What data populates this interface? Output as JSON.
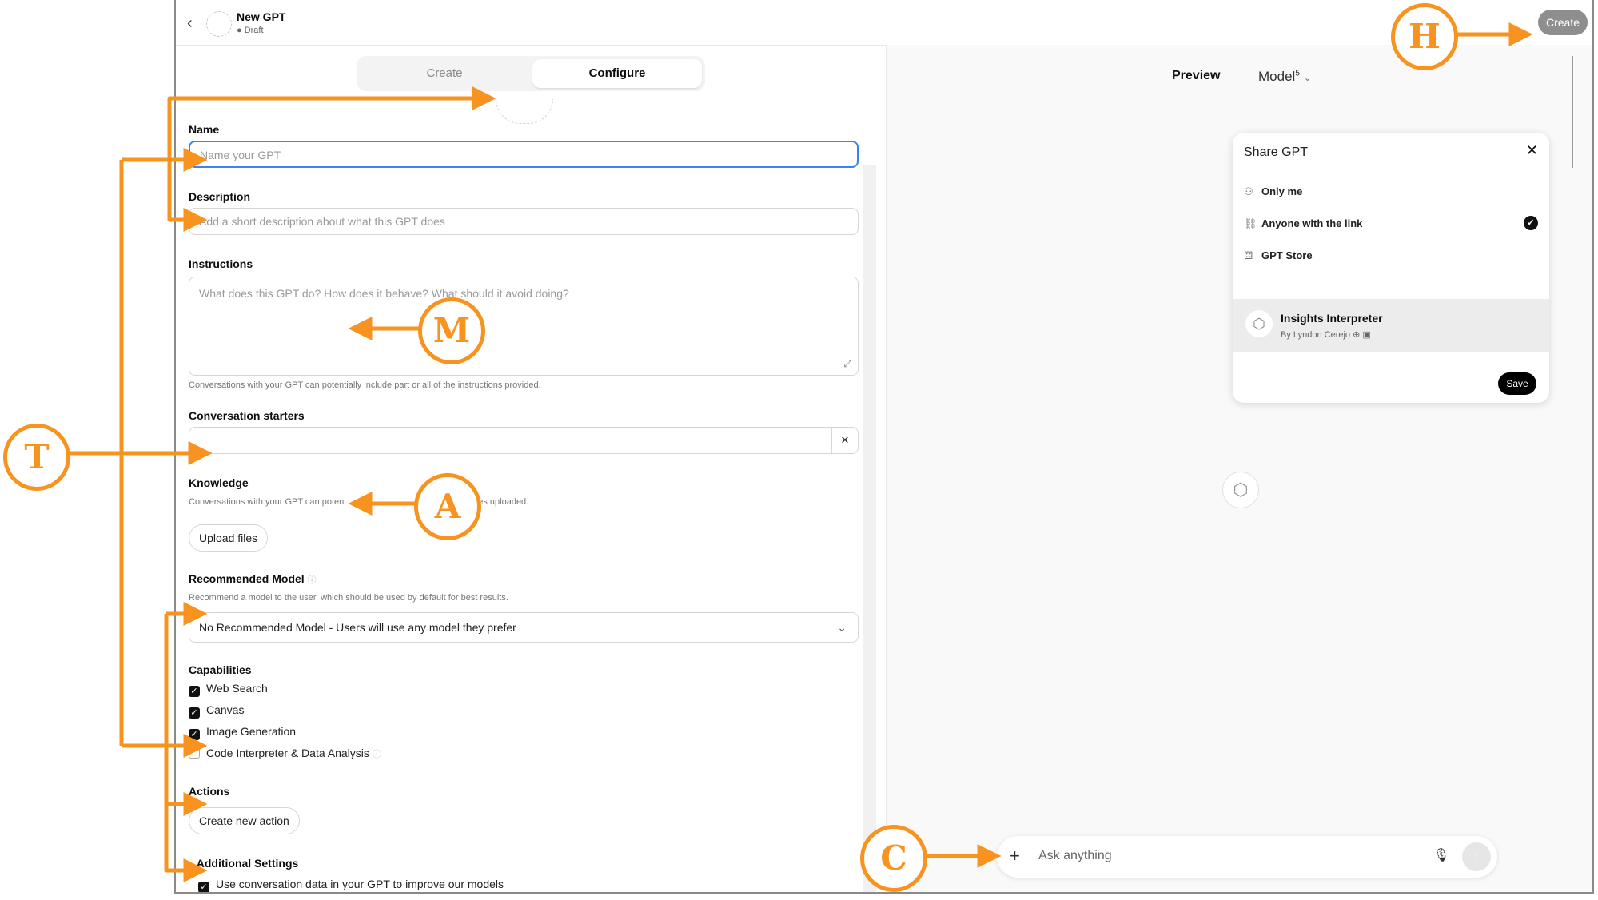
{
  "header": {
    "back": "‹",
    "title": "New GPT",
    "status": "● Draft",
    "create_button": "Create"
  },
  "tabs": [
    {
      "label": "Create"
    },
    {
      "label": "Configure"
    }
  ],
  "form": {
    "name_label": "Name",
    "name_placeholder": "Name your GPT",
    "description_label": "Description",
    "description_placeholder": "Add a short description about what this GPT does",
    "instructions_label": "Instructions",
    "instructions_placeholder": "What does this GPT do? How does it behave? What should it avoid doing?",
    "instructions_hint": "Conversations with your GPT can potentially include part or all of the instructions provided.",
    "starters_label": "Conversation starters",
    "starter_remove": "✕",
    "knowledge_label": "Knowledge",
    "knowledge_hint_start": "Conversations with your GPT can poten",
    "knowledge_hint_end": "es uploaded.",
    "upload_button": "Upload files",
    "model_label": "Recommended Model",
    "model_hint": "Recommend a model to the user, which should be used by default for best results.",
    "model_value": "No Recommended Model - Users will use any model they prefer",
    "capabilities_label": "Capabilities",
    "capabilities": [
      {
        "label": "Web Search",
        "checked": true
      },
      {
        "label": "Canvas",
        "checked": true
      },
      {
        "label": "Image Generation",
        "checked": true
      },
      {
        "label": "Code Interpreter & Data Analysis",
        "checked": false
      }
    ],
    "actions_label": "Actions",
    "create_action_button": "Create new action",
    "additional_label": "Additional Settings",
    "improve_label": "Use conversation data in your GPT to improve our models"
  },
  "preview": {
    "title": "Preview",
    "model": "Model",
    "model_sup": "5",
    "chat_placeholder": "Ask anything",
    "share": {
      "title": "Share GPT",
      "options": [
        "Only me",
        "Anyone with the link",
        "GPT Store"
      ],
      "selected": "Anyone with the link",
      "card_name": "Insights Interpreter",
      "card_by": "By Lyndon Cerejo",
      "save": "Save"
    }
  },
  "annotations": {
    "labels": [
      "H",
      "M",
      "T",
      "A",
      "C"
    ],
    "color": "#f7931e"
  }
}
